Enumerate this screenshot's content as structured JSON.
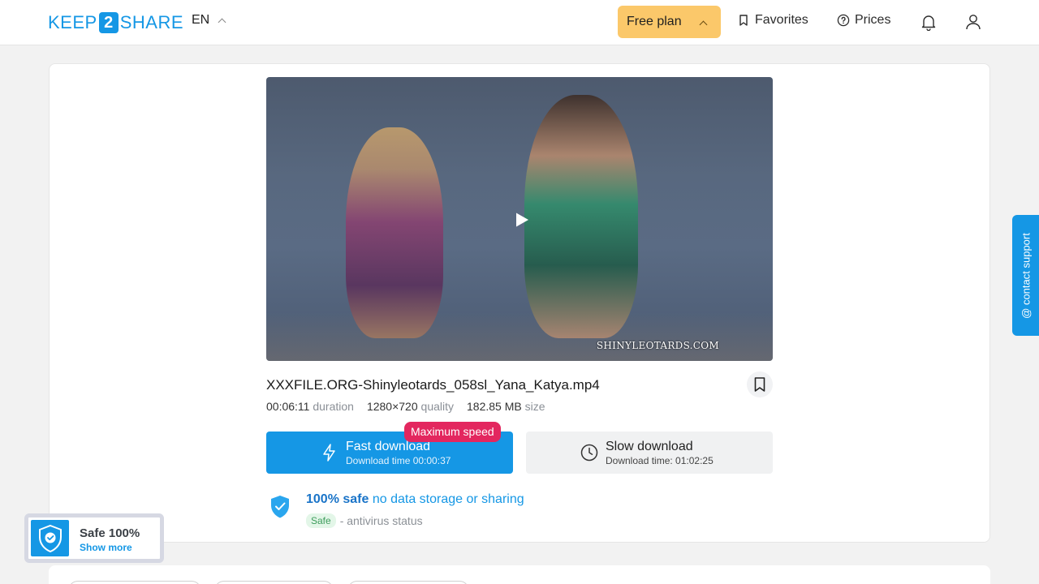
{
  "header": {
    "logo": {
      "left": "KEEP",
      "number": "2",
      "right": "SHARE"
    },
    "language": "EN",
    "plan_label": "Free plan",
    "favorites_label": "Favorites",
    "prices_label": "Prices"
  },
  "file": {
    "name": "XXXFILE.ORG-Shinyleotards_058sl_Yana_Katya.mp4",
    "duration_value": "00:06:11",
    "duration_unit": "duration",
    "quality_value": "1280×720",
    "quality_unit": "quality",
    "size_value": "182.85 MB",
    "size_unit": "size",
    "video_watermark": "SHINYLEOTARDS.COM"
  },
  "download": {
    "fast_label": "Fast download",
    "fast_time": "Download time 00:00:37",
    "badge": "Maximum speed",
    "slow_label": "Slow download",
    "slow_time": "Download time: 01:02:25"
  },
  "safety": {
    "strong": "100% safe",
    "rest": "no data storage or sharing",
    "pill": "Safe",
    "status_text": "- antivirus status"
  },
  "support_tab": "@ contact support",
  "safe_widget": {
    "title": "Safe 100%",
    "link": "Show more"
  },
  "colors": {
    "brand_blue": "#1597e5",
    "plan_yellow": "#fbc86a",
    "badge_pink": "#e3275f",
    "safe_green": "#3f9d5d"
  },
  "icons": [
    "chevron-up-icon",
    "bookmark-icon",
    "help-circle-icon",
    "bell-icon",
    "user-icon",
    "play-icon",
    "lightning-icon",
    "clock-icon",
    "shield-check-icon"
  ]
}
